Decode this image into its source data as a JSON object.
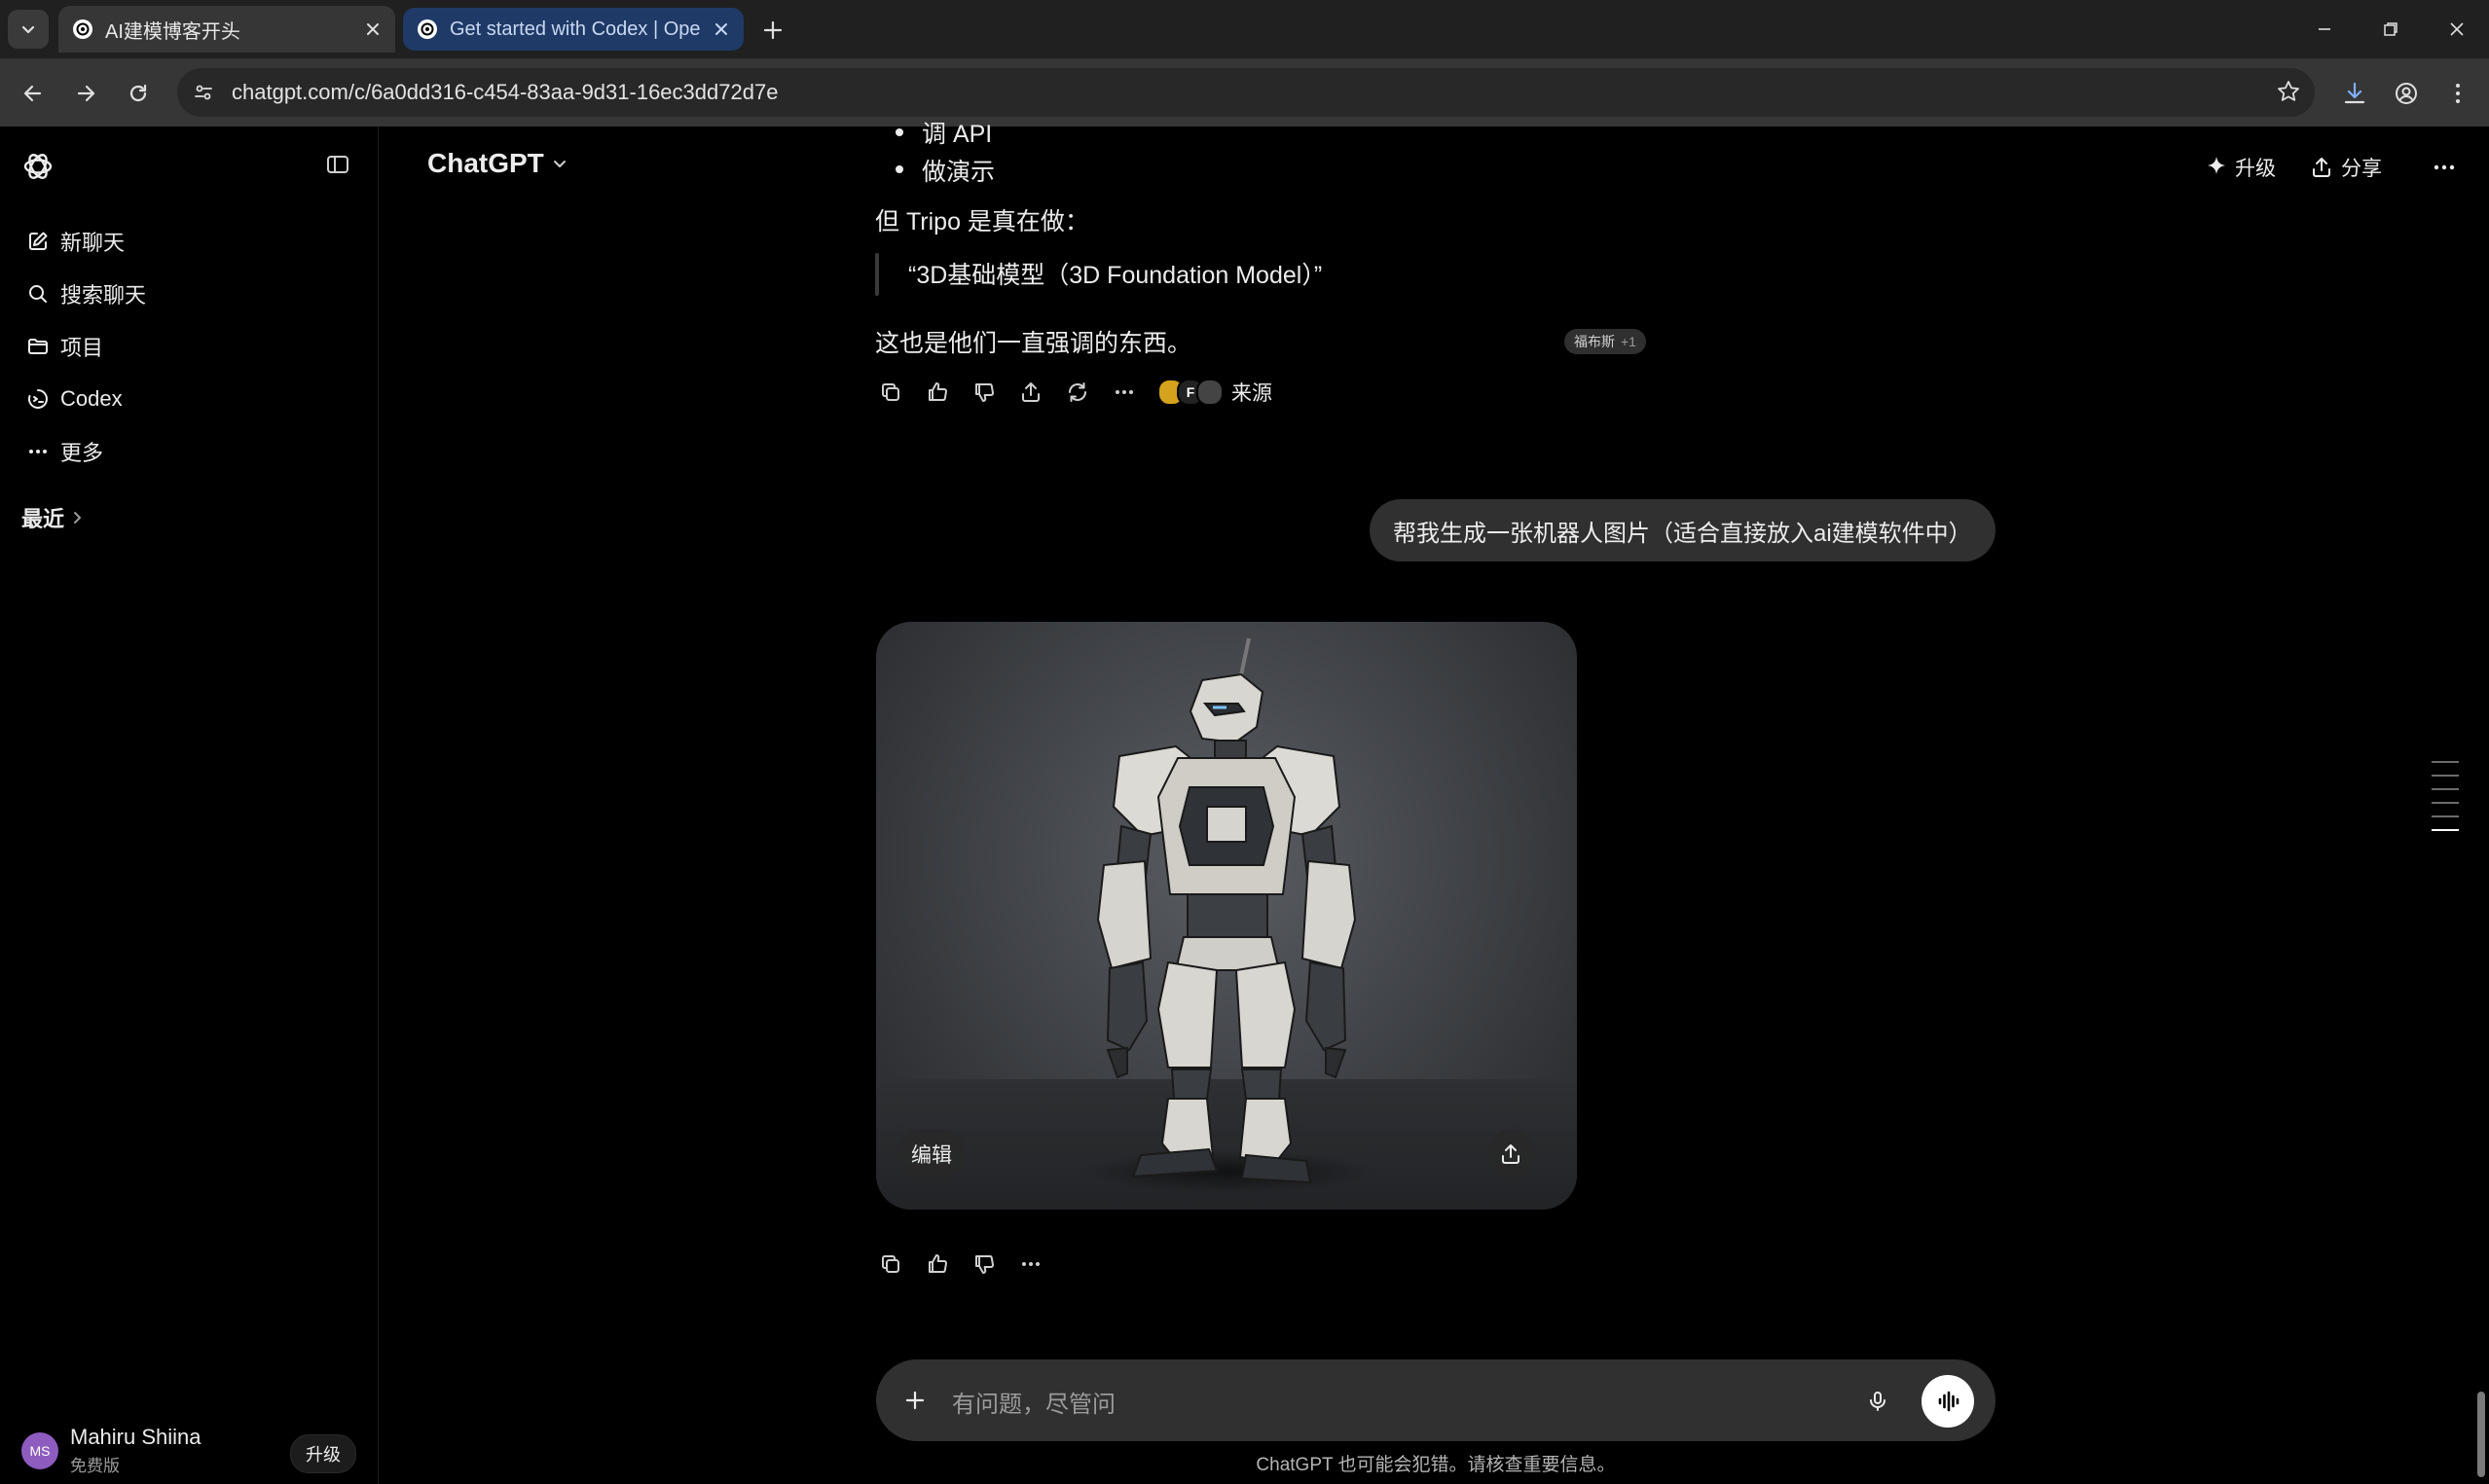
{
  "browser": {
    "tabs": [
      {
        "title": "AI建模博客开头",
        "active": true
      },
      {
        "title": "Get started with Codex | Ope",
        "active": false
      }
    ],
    "url": "chatgpt.com/c/6a0dd316-c454-83aa-9d31-16ec3dd72d7e"
  },
  "sidebar": {
    "items": [
      {
        "label": "新聊天",
        "icon": "compose-icon"
      },
      {
        "label": "搜索聊天",
        "icon": "search-icon"
      },
      {
        "label": "项目",
        "icon": "folder-icon"
      },
      {
        "label": "Codex",
        "icon": "codex-icon"
      },
      {
        "label": "更多",
        "icon": "ellipsis-icon"
      }
    ],
    "recent_label": "最近",
    "user": {
      "initials": "MS",
      "name": "Mahiru Shiina",
      "plan": "免费版",
      "upgrade_label": "升级"
    }
  },
  "header": {
    "model": "ChatGPT",
    "upgrade_label": "升级",
    "share_label": "分享"
  },
  "conversation": {
    "bullets": [
      "调 API",
      "做演示"
    ],
    "para1": "但 Tripo 是真在做：",
    "quote": "“3D基础模型（3D Foundation Model）”",
    "para2": "这也是他们一直强调的东西。",
    "citation": {
      "label": "福布斯",
      "extra": "+1"
    },
    "sources_label": "来源",
    "user_message": "帮我生成一张机器人图片（适合直接放入ai建模软件中）",
    "image_edit_label": "编辑"
  },
  "composer": {
    "placeholder": "有问题，尽管问",
    "disclaimer": "ChatGPT 也可能会犯错。请核查重要信息。"
  },
  "colors": {
    "background": "#000000",
    "composer": "#303030",
    "user_bubble": "#303030",
    "active_tab": "#1f3a66"
  }
}
